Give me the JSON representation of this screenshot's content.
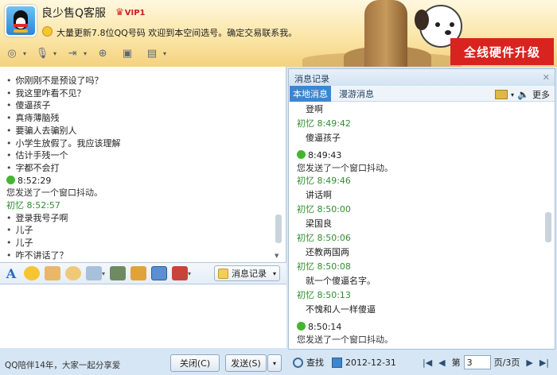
{
  "contact": {
    "name": "良少售Q客服",
    "vip_label": "VIP1",
    "signature": "大量更新7.8位QQ号码  欢迎到本空间选号。确定交易联系我。"
  },
  "ad": {
    "label": "全线硬件升级",
    "color": "#d9231e"
  },
  "chat_lines": [
    {
      "type": "bullet",
      "text": "你刚刚不是预设了吗？"
    },
    {
      "type": "bullet",
      "text": "我这里咋看不见？"
    },
    {
      "type": "bullet",
      "text": "傻逼孩子"
    },
    {
      "type": "bullet",
      "text": "真痔薄脑残"
    },
    {
      "type": "bullet",
      "text": "要骗人去骗别人"
    },
    {
      "type": "bullet",
      "text": "小学生放假了。我应该理解"
    },
    {
      "type": "bullet",
      "text": "估计手残一个"
    },
    {
      "type": "bullet",
      "text": "字都不会打"
    },
    {
      "type": "ok-time",
      "text": "8:52:29"
    },
    {
      "type": "sys",
      "text": "您发送了一个窗口抖动。"
    },
    {
      "type": "sender",
      "text": "初忆  8:52:57"
    },
    {
      "type": "bullet",
      "text": "登录我号子啊"
    },
    {
      "type": "bullet",
      "text": "儿子"
    },
    {
      "type": "bullet",
      "text": "儿子"
    },
    {
      "type": "bullet",
      "text": "咋不讲话了？"
    }
  ],
  "format_bar": {
    "msg_record_label": "消息记录"
  },
  "bottom": {
    "promo": "QQ陪伴14年，大家一起分享爱",
    "close_label": "关闭(C)",
    "send_label": "发送(S)"
  },
  "history": {
    "title": "消息记录",
    "tab_local": "本地消息",
    "tab_roam": "漫游消息",
    "more": "更多",
    "entries": [
      {
        "type": "msg",
        "text": "登啊"
      },
      {
        "type": "sender",
        "text": "初忆  8:49:42"
      },
      {
        "type": "msg",
        "text": "傻逼孩子"
      },
      {
        "type": "ok-time",
        "text": "8:49:43"
      },
      {
        "type": "sys",
        "text": "您发送了一个窗口抖动。"
      },
      {
        "type": "sender",
        "text": "初忆  8:49:46"
      },
      {
        "type": "msg",
        "text": "讲话啊"
      },
      {
        "type": "sender",
        "text": "初忆  8:50:00"
      },
      {
        "type": "msg",
        "text": " 梁国良"
      },
      {
        "type": "sender",
        "text": "初忆  8:50:06"
      },
      {
        "type": "msg",
        "text": "还教两国两"
      },
      {
        "type": "sender",
        "text": "初忆  8:50:08"
      },
      {
        "type": "msg",
        "text": "就一个傻逼名字。"
      },
      {
        "type": "sender",
        "text": "初忆  8:50:13"
      },
      {
        "type": "msg",
        "text": "不愧和人一样傻逼"
      },
      {
        "type": "ok-time",
        "text": "8:50:14"
      },
      {
        "type": "sys",
        "text": "您发送了一个窗口抖动。"
      }
    ],
    "search_label": "查找",
    "date": "2012-12-31",
    "page_prefix": "第",
    "page_value": "3",
    "page_suffix": "页/3页"
  }
}
